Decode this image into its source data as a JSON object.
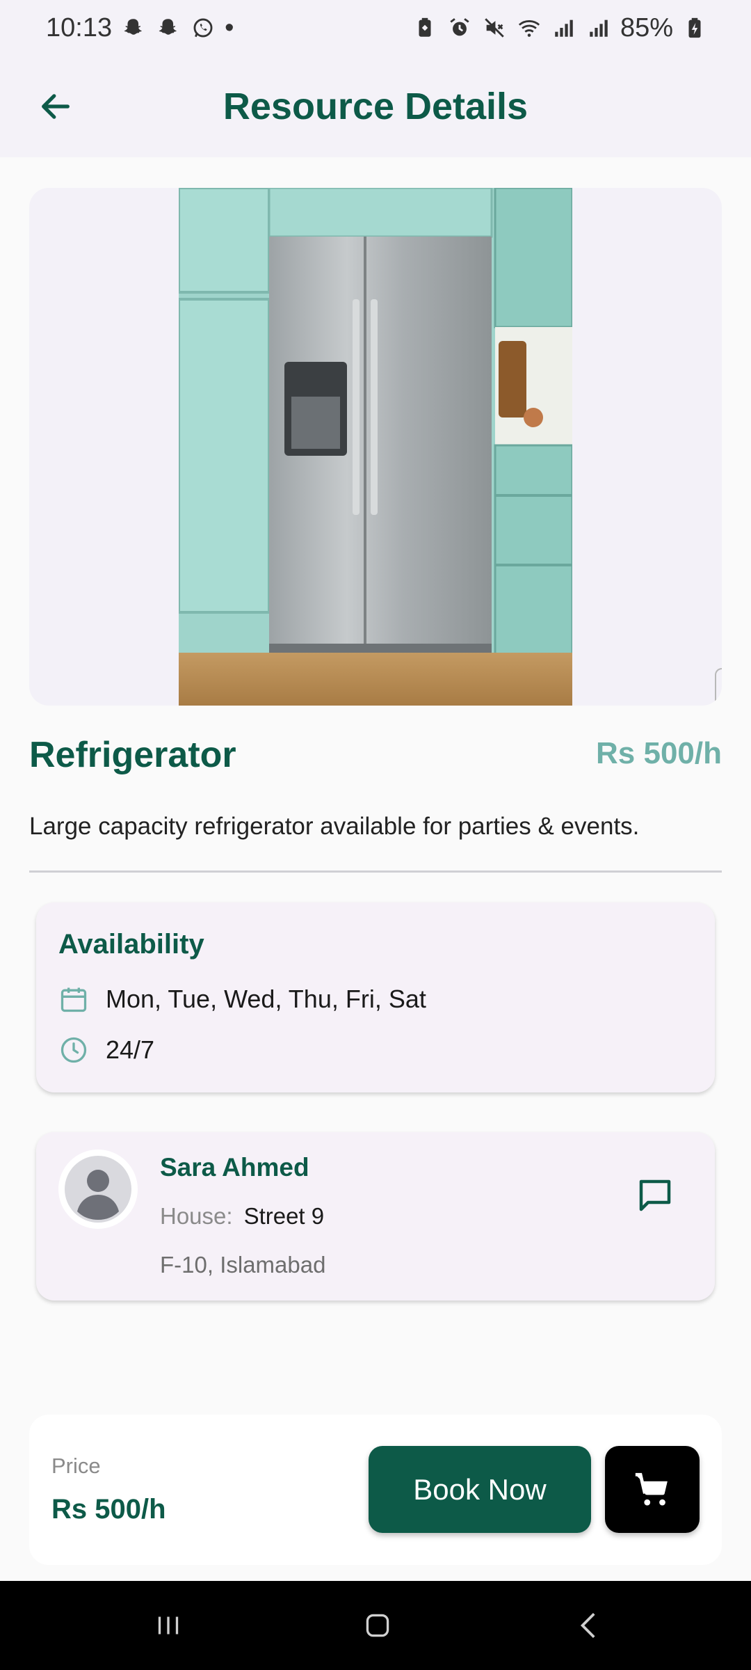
{
  "status_bar": {
    "time": "10:13",
    "dot": "•",
    "battery": "85%",
    "left_icons": [
      "snapchat-icon",
      "snapchat-icon",
      "whatsapp-icon"
    ],
    "right_icons": [
      "battery-saver-icon",
      "alarm-icon",
      "mute-icon",
      "wifi-icon",
      "signal-icon",
      "signal-icon",
      "battery-charging-icon"
    ]
  },
  "header": {
    "title": "Resource Details",
    "back_icon": "arrow-left-icon"
  },
  "resource": {
    "name": "Refrigerator",
    "price": "Rs 500/h",
    "description": "Large capacity refrigerator available for parties & events."
  },
  "availability": {
    "title": "Availability",
    "days": "Mon, Tue, Wed, Thu, Fri, Sat",
    "hours": "24/7"
  },
  "owner": {
    "name": "Sara Ahmed",
    "house_label": "House:",
    "house_value": "Street 9",
    "area": "F-10, Islamabad"
  },
  "footer": {
    "price_label": "Price",
    "price_value": "Rs 500/h",
    "book_label": "Book Now",
    "cart_icon": "cart-icon"
  },
  "colors": {
    "primary": "#0d5a48",
    "accent": "#6fb0a8",
    "card_bg": "#f6f1f8"
  }
}
